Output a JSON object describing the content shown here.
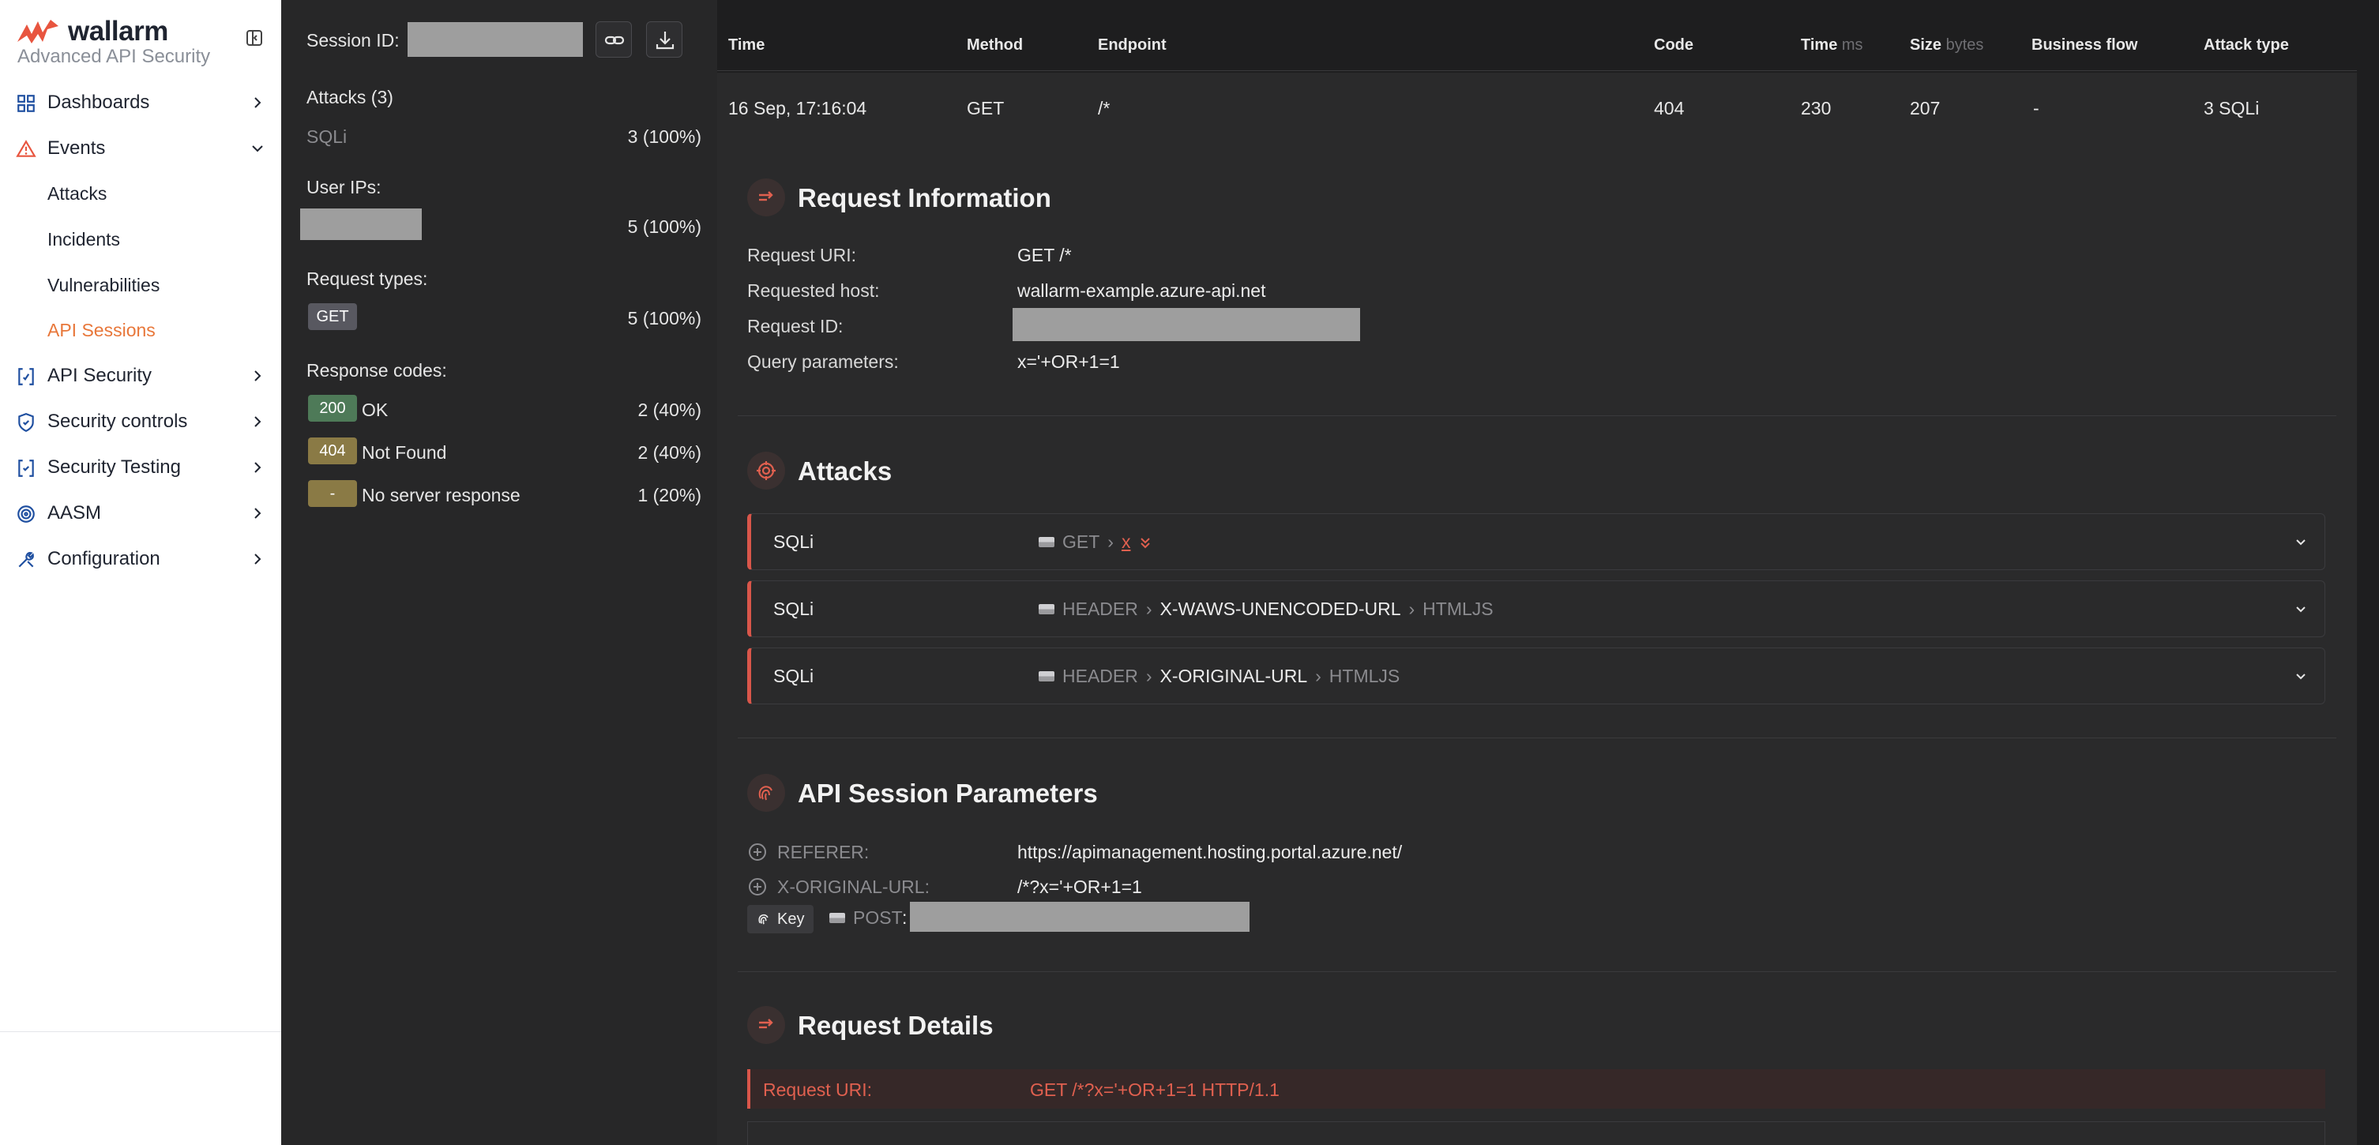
{
  "brand": {
    "name": "wallarm",
    "subtitle": "Advanced API Security",
    "accent": "#e8773a"
  },
  "sidebar": {
    "items": [
      {
        "label": "Dashboards",
        "icon": "grid-icon"
      },
      {
        "label": "Events",
        "icon": "warning-triangle-icon",
        "expanded": true
      },
      {
        "label": "API Security",
        "icon": "api-brackets-icon"
      },
      {
        "label": "Security controls",
        "icon": "shield-icon"
      },
      {
        "label": "Security Testing",
        "icon": "testing-brackets-icon"
      },
      {
        "label": "AASM",
        "icon": "fingerprint-icon"
      },
      {
        "label": "Configuration",
        "icon": "tools-icon"
      }
    ],
    "events_children": [
      "Attacks",
      "Incidents",
      "Vulnerabilities",
      "API Sessions"
    ],
    "active_child": "API Sessions"
  },
  "summary": {
    "session_label": "Session ID:",
    "attacks_heading": "Attacks (3)",
    "attacks": [
      {
        "label": "SQLi",
        "value": "3 (100%)"
      }
    ],
    "user_ips_heading": "User IPs:",
    "user_ips_value": "5 (100%)",
    "request_types_heading": "Request types:",
    "request_types": [
      {
        "badge": "GET",
        "value": "5 (100%)"
      }
    ],
    "response_codes_heading": "Response codes:",
    "response_codes": [
      {
        "badge": "200",
        "label": "OK",
        "value": "2 (40%)",
        "color": "#4e7a58"
      },
      {
        "badge": "404",
        "label": "Not Found",
        "value": "2 (40%)",
        "color": "#8a7a45"
      },
      {
        "badge": "-",
        "label": "No server response",
        "value": "1 (20%)",
        "color": "#8a7a45"
      }
    ]
  },
  "table": {
    "headers": {
      "time": "Time",
      "method": "Method",
      "endpoint": "Endpoint",
      "code": "Code",
      "time_ms": "Time",
      "time_ms_unit": "ms",
      "size": "Size",
      "size_unit": "bytes",
      "business_flow": "Business flow",
      "attack_type": "Attack type"
    },
    "row": {
      "time": "16 Sep, 17:16:04",
      "method": "GET",
      "endpoint": "/*",
      "code": "404",
      "time_ms": "230",
      "size": "207",
      "business_flow": "-",
      "attack_type": "3 SQLi"
    }
  },
  "request_info": {
    "title": "Request Information",
    "uri_label": "Request URI:",
    "uri": "GET /*",
    "host_label": "Requested host:",
    "host": "wallarm-example.azure-api.net",
    "id_label": "Request ID:",
    "query_label": "Query parameters:",
    "query": "x='+OR+1=1"
  },
  "attacks_section": {
    "title": "Attacks",
    "rows": [
      {
        "type": "SQLi",
        "p1": "GET",
        "p2": "x",
        "p3": ""
      },
      {
        "type": "SQLi",
        "p1": "HEADER",
        "p2": "X-WAWS-UNENCODED-URL",
        "p3": "HTMLJS"
      },
      {
        "type": "SQLi",
        "p1": "HEADER",
        "p2": "X-ORIGINAL-URL",
        "p3": "HTMLJS"
      }
    ]
  },
  "session_params": {
    "title": "API Session Parameters",
    "referer_label": "REFERER:",
    "referer": "https://apimanagement.hosting.portal.azure.net/",
    "orig_label": "X-ORIGINAL-URL:",
    "orig": "/*?x='+OR+1=1",
    "key_label": "Key",
    "post_label": "POST",
    "post_sep": ":"
  },
  "request_details": {
    "title": "Request Details",
    "uri_label": "Request URI:",
    "uri": "GET /*?x='+OR+1=1 HTTP/1.1"
  },
  "colors": {
    "danger": "#d9564a",
    "sidebar_bg": "#ffffff",
    "panel_bg": "#272728",
    "main_bg": "#2a2a2b"
  }
}
